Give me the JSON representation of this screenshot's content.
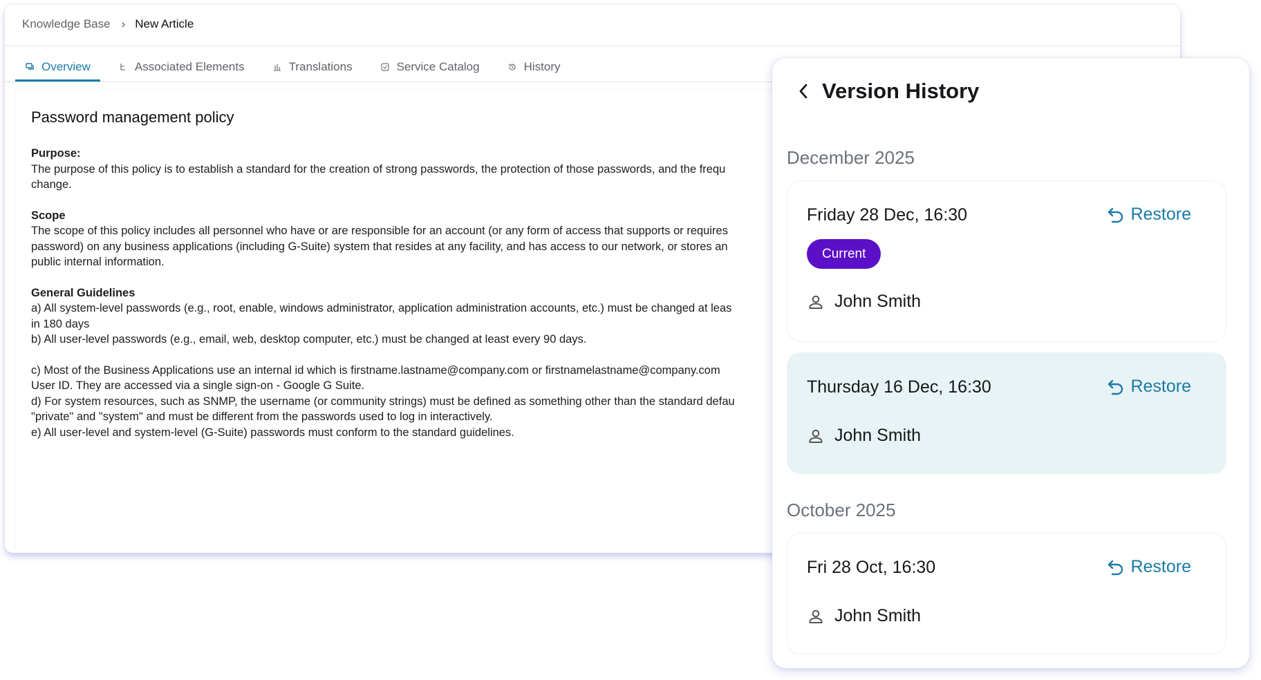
{
  "breadcrumb": {
    "root": "Knowledge Base",
    "separator": "›",
    "current": "New Article"
  },
  "tabs": [
    {
      "label": "Overview",
      "icon": "chat-icon",
      "active": true
    },
    {
      "label": "Associated Elements",
      "icon": "hierarchy-icon",
      "active": false
    },
    {
      "label": "Translations",
      "icon": "bar-chart-icon",
      "active": false
    },
    {
      "label": "Service Catalog",
      "icon": "checkbox-icon",
      "active": false
    },
    {
      "label": "History",
      "icon": "history-icon",
      "active": false
    }
  ],
  "article": {
    "title": "Password management policy",
    "purpose_heading": "Purpose:",
    "purpose_lines": [
      "The purpose of this policy is to establish a standard for the creation of strong passwords, the protection of those passwords, and the frequ",
      "change."
    ],
    "scope_heading": "Scope",
    "scope_lines": [
      "The scope of this policy includes all personnel who have or are responsible for an account (or any form of access that supports or requires",
      "password) on any business applications (including G-Suite) system that resides at any facility, and has access to our network, or stores an",
      "public internal information."
    ],
    "guidelines_heading": "General Guidelines",
    "guidelines_lines": [
      "a) All system-level passwords (e.g., root, enable, windows administrator, application administration accounts, etc.) must be changed at leas",
      "in 180 days",
      "b) All user-level passwords (e.g., email, web, desktop computer, etc.) must be changed at least every 90 days."
    ],
    "guidelines2_lines": [
      "c) Most of the Business Applications use an internal id which is firstname.lastname@company.com or firstnamelastname@company.com",
      "User ID. They are accessed via a single sign-on - Google G Suite.",
      "d) For system resources, such as SNMP, the username (or community strings) must be defined as something other than the standard defau",
      "\"private\" and \"system\" and must be different from the passwords used to log in interactively.",
      "e) All user-level and system-level (G-Suite) passwords must conform to the standard guidelines."
    ]
  },
  "version_history": {
    "title": "Version History",
    "groups": [
      {
        "month": "December 2025",
        "versions": [
          {
            "date": "Friday 28 Dec, 16:30",
            "restore_label": "Restore",
            "badge": "Current",
            "author": "John Smith"
          },
          {
            "date": "Thursday 16 Dec, 16:30",
            "restore_label": "Restore",
            "author": "John Smith"
          }
        ]
      },
      {
        "month": "October 2025",
        "versions": [
          {
            "date": "Fri 28 Oct, 16:30",
            "restore_label": "Restore",
            "author": "John Smith"
          }
        ]
      }
    ]
  },
  "colors": {
    "accent": "#1a7ba6",
    "badge": "#5b0fc7",
    "highlight_card": "#e8f3f5",
    "muted_text": "#6b717a"
  }
}
